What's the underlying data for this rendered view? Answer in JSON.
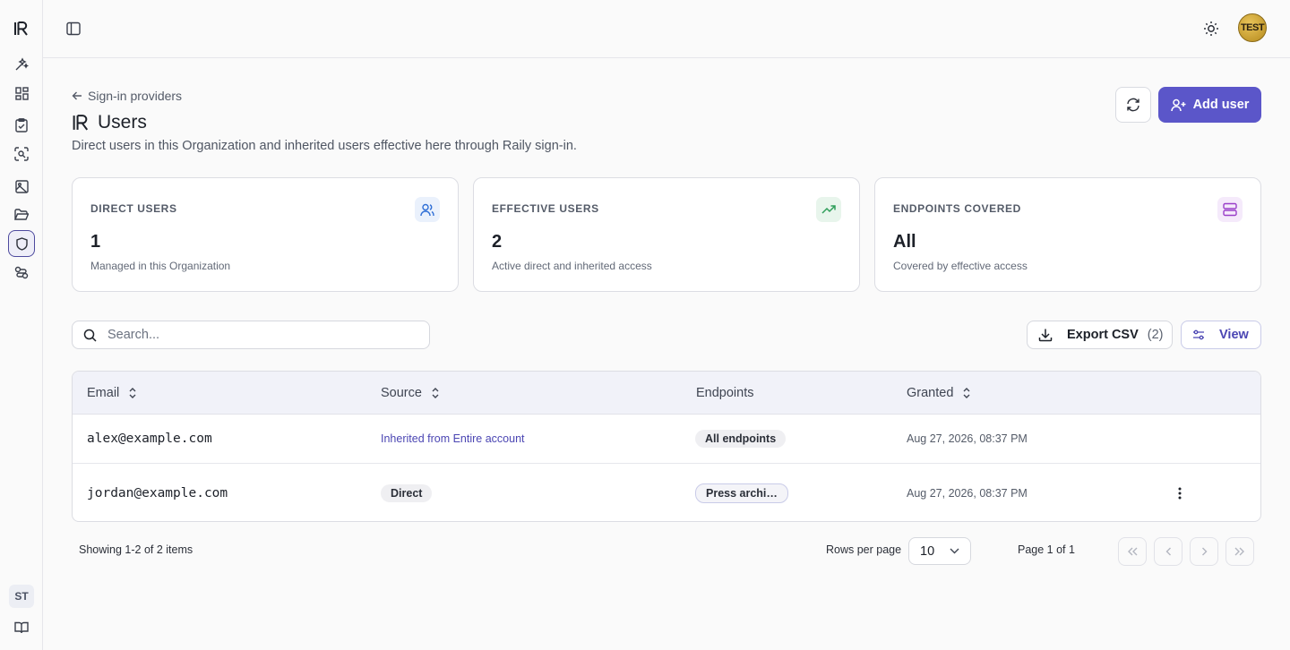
{
  "sidebar": {
    "logo": "IR",
    "items": [
      {
        "name": "sparkles-icon"
      },
      {
        "name": "dashboard-grid-icon"
      },
      {
        "name": "clipboard-check-icon"
      },
      {
        "name": "scan-face-icon"
      },
      {
        "name": "image-icon"
      },
      {
        "name": "folder-open-icon"
      },
      {
        "name": "shield-icon",
        "active": true
      },
      {
        "name": "handshake-icon"
      }
    ],
    "user_initials": "ST"
  },
  "topbar": {
    "avatar_text": "TEST"
  },
  "header": {
    "back_label": "Sign-in providers",
    "title": "Users",
    "subtitle": "Direct users in this Organization and inherited users effective here through Raily sign-in.",
    "add_button_label": "Add user"
  },
  "stats": [
    {
      "label": "DIRECT USERS",
      "value": "1",
      "description": "Managed in this Organization",
      "icon": "users-icon",
      "accent": "#2f6fd6"
    },
    {
      "label": "EFFECTIVE USERS",
      "value": "2",
      "description": "Active direct and inherited access",
      "icon": "trending-up-icon",
      "accent": "#2f9e5a"
    },
    {
      "label": "ENDPOINTS COVERED",
      "value": "All",
      "description": "Covered by effective access",
      "icon": "server-icon",
      "accent": "#9a3fc9"
    }
  ],
  "toolbar": {
    "search_placeholder": "Search...",
    "export_label": "Export CSV",
    "export_count": "(2)",
    "view_label": "View"
  },
  "table": {
    "columns": [
      "Email",
      "Source",
      "Endpoints",
      "Granted"
    ],
    "rows": [
      {
        "email": "alex@example.com",
        "source": "Inherited from Entire account",
        "source_type": "link",
        "endpoints": "All endpoints",
        "granted": "Aug 27, 2026, 08:37 PM"
      },
      {
        "email": "jordan@example.com",
        "source": "Direct",
        "source_type": "badge",
        "endpoints": "Press archi…",
        "granted": "Aug 27, 2026, 08:37 PM"
      }
    ]
  },
  "pagination": {
    "showing": "Showing 1-2 of 2 items",
    "rows_per_page_label": "Rows per page",
    "rows_per_page_value": "10",
    "page_info": "Page 1 of 1"
  },
  "colors": {
    "primary": "#5b56c9",
    "link": "#4b46b3"
  }
}
